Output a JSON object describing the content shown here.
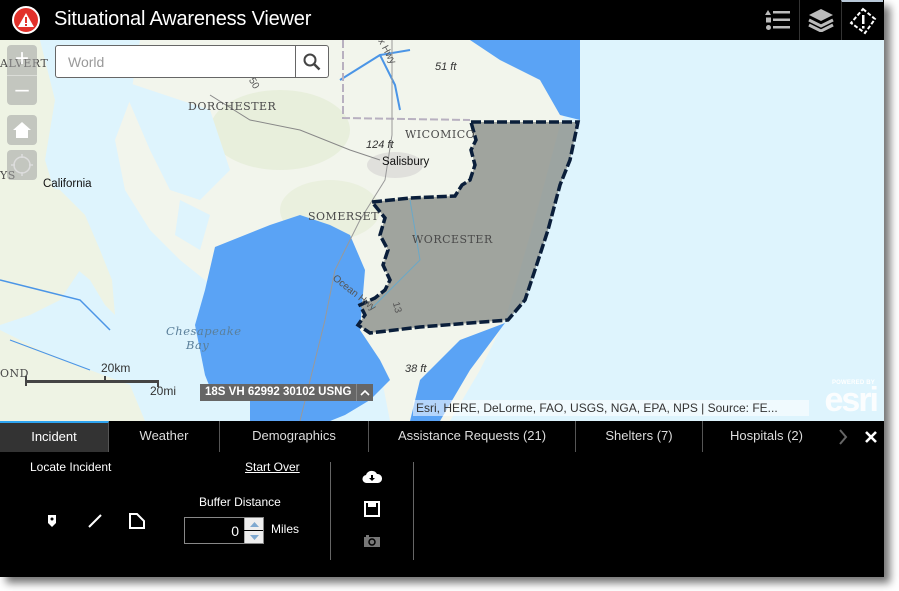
{
  "header": {
    "title": "Situational Awareness Viewer",
    "buttons": [
      {
        "name": "legend",
        "icon": "legend-list-icon"
      },
      {
        "name": "layers",
        "icon": "layers-icon"
      },
      {
        "name": "alert",
        "icon": "alert-diamond-icon"
      }
    ]
  },
  "map": {
    "search": {
      "placeholder": "World",
      "value": ""
    },
    "controls": {
      "zoom_in": "+",
      "zoom_out": "–"
    },
    "labels": {
      "calvert": "ALVERT",
      "dorchester": "DORCHESTER",
      "wicomico": "WICOMICO",
      "somerset": "SOMERSET",
      "worcester": "WORCESTER",
      "stmarys": "YS",
      "richmond": "OND",
      "salisbury": "Salisbury",
      "california": "California",
      "chesapeake": "Chesapeake",
      "bay": "Bay",
      "elev_51": "51 ft",
      "elev_124": "124 ft",
      "elev_38": "38 ft",
      "hwy_ocean": "Ocean Hwy",
      "hwy_13": "13",
      "hwy_50": "50",
      "hwy_dx": "x Hwy"
    },
    "scalebar": {
      "km": "20km",
      "mi": "20mi"
    },
    "coordinates": "18S VH 62992 30102 USNG",
    "attribution": "Esri, HERE, DeLorme, FAO, USGS, NGA, EPA, NPS | Source: FE...",
    "esri": {
      "powered_by": "POWERED BY",
      "brand": "esri"
    },
    "colors": {
      "water": "#def4fd",
      "land": "#eef3e4",
      "flood": "#5aa3f5",
      "selection_fill": "#9aa09a",
      "selection_outline": "#0a1e3a"
    }
  },
  "tabs": [
    {
      "label": "Incident",
      "active": true
    },
    {
      "label": "Weather",
      "active": false
    },
    {
      "label": "Demographics",
      "active": false
    },
    {
      "label": "Assistance Requests (21)",
      "active": false
    },
    {
      "label": "Shelters (7)",
      "active": false
    },
    {
      "label": "Hospitals (2)",
      "active": false
    }
  ],
  "panel": {
    "locate_label": "Locate Incident",
    "start_over": "Start Over",
    "draw_tools": [
      "point-marker-icon",
      "line-icon",
      "polygon-icon"
    ],
    "buffer_label": "Buffer Distance",
    "buffer_value": "0",
    "buffer_unit": "Miles",
    "actions": [
      "download-cloud-icon",
      "save-icon",
      "camera-icon"
    ]
  },
  "accent_color": "#2ea4f0"
}
